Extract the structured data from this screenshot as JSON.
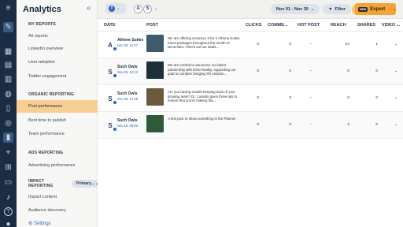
{
  "app": {
    "title": "Analytics",
    "collapse_icon": "double-chevron-left-icon"
  },
  "sidebar": {
    "sections": [
      {
        "label": "MY REPORTS",
        "items": [
          "All reports",
          "LinkedIn overview",
          "User adoption",
          "Twitter engagement"
        ]
      },
      {
        "label": "ORGANIC REPORTING",
        "items": [
          "Post performance",
          "Best time to publish",
          "Team performance"
        ]
      },
      {
        "label": "ADS REPORTING",
        "items": [
          "Advertising performance"
        ]
      },
      {
        "label": "IMPACT REPORTING",
        "items": [
          "Impact content",
          "Audience discovery"
        ]
      }
    ],
    "active_item": "Post performance",
    "impact_pill": "Primary...",
    "settings_label": "⚙ Settings"
  },
  "toolbar": {
    "network_icon": "f",
    "profile_avatars": [
      "A",
      "S"
    ],
    "date_range": "Nov 01 - Nov 30",
    "filter_label": "Filter",
    "export_badge": "NEW",
    "export_label": "Export"
  },
  "table": {
    "columns": [
      "DATE",
      "POST",
      "CLICKS",
      "COMME...",
      "HOT POST",
      "REACH",
      "SHARES",
      "VIDEO ..."
    ],
    "rows": [
      {
        "account": "Athene Suites",
        "date": "Nov 09, 12:27",
        "avatar": "A",
        "thumb_color": "#3e5a6e",
        "text": "We are offering exclusive 2-for-1 Athene Suites travel packages throughout the month of December. Check out our deals...",
        "clicks": "0",
        "comments": "0",
        "reach": "24",
        "shares": "1"
      },
      {
        "account": "Such Owls",
        "date": "Nov 05, 13:13",
        "avatar": "S",
        "thumb_color": "#1f2f3a",
        "text": "We are excited to announce our latest partnership with EON Reality, supporting our goal to combine bringing XR solution...",
        "clicks": "0",
        "comments": "0",
        "reach": "0",
        "shares": "0"
      },
      {
        "account": "Such Owls",
        "date": "Nov 05, 13:08",
        "avatar": "S",
        "thumb_color": "#6b5a3e",
        "text": "Are you having trouble keeping track of your growing team? Dr. Cassidy gives three tips to ensure that you're making the...",
        "clicks": "0",
        "comments": "0",
        "reach": "0",
        "shares": "0"
      },
      {
        "account": "Such Owls",
        "date": "Nov 16, 09:00",
        "avatar": "S",
        "thumb_color": "#2f5a3a",
        "text": "A test post to show something in the Planner",
        "clicks": "0",
        "comments": "0",
        "reach": "2",
        "shares": "0"
      }
    ]
  }
}
